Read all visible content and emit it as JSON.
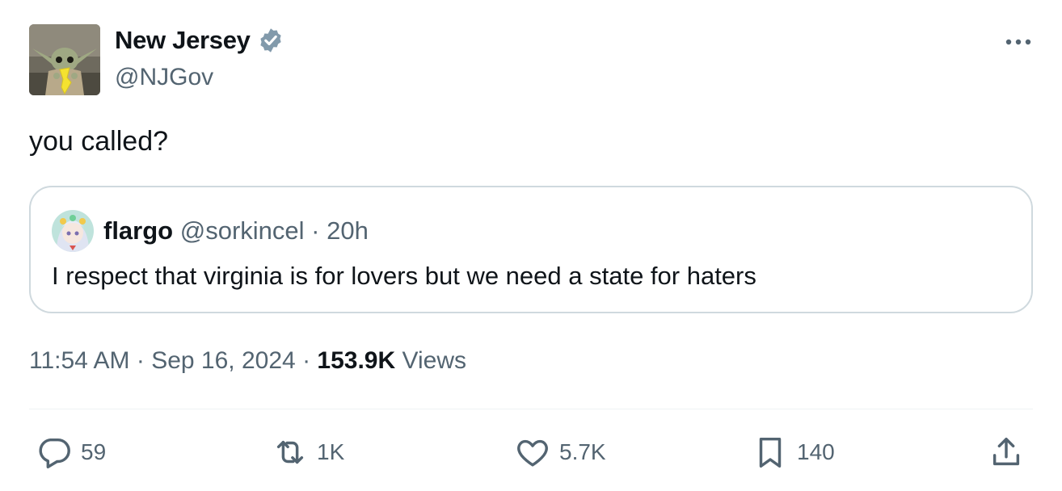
{
  "author": {
    "display_name": "New Jersey",
    "handle": "@NJGov",
    "verified": true,
    "avatar_icon": "baby-yoda-holding-new-jersey-avatar"
  },
  "tweet": {
    "text": "you called?"
  },
  "quoted_tweet": {
    "display_name": "flargo",
    "handle": "@sorkincel",
    "separator": "·",
    "time": "20h",
    "text": "I respect that virginia is for lovers but we need a state for haters",
    "avatar_icon": "anime-character-avatar"
  },
  "meta": {
    "time": "11:54 AM",
    "separator": "·",
    "date": "Sep 16, 2024",
    "views_count": "153.9K",
    "views_label": "Views"
  },
  "actions": {
    "reply": {
      "icon": "reply-icon",
      "count": "59"
    },
    "retweet": {
      "icon": "retweet-icon",
      "count": "1K"
    },
    "like": {
      "icon": "heart-icon",
      "count": "5.7K"
    },
    "bookmark": {
      "icon": "bookmark-icon",
      "count": "140"
    },
    "share": {
      "icon": "share-icon"
    }
  },
  "colors": {
    "text_primary": "#0f1419",
    "text_secondary": "#536471",
    "border": "#cfd9de",
    "verified_badge": "#829aab"
  }
}
